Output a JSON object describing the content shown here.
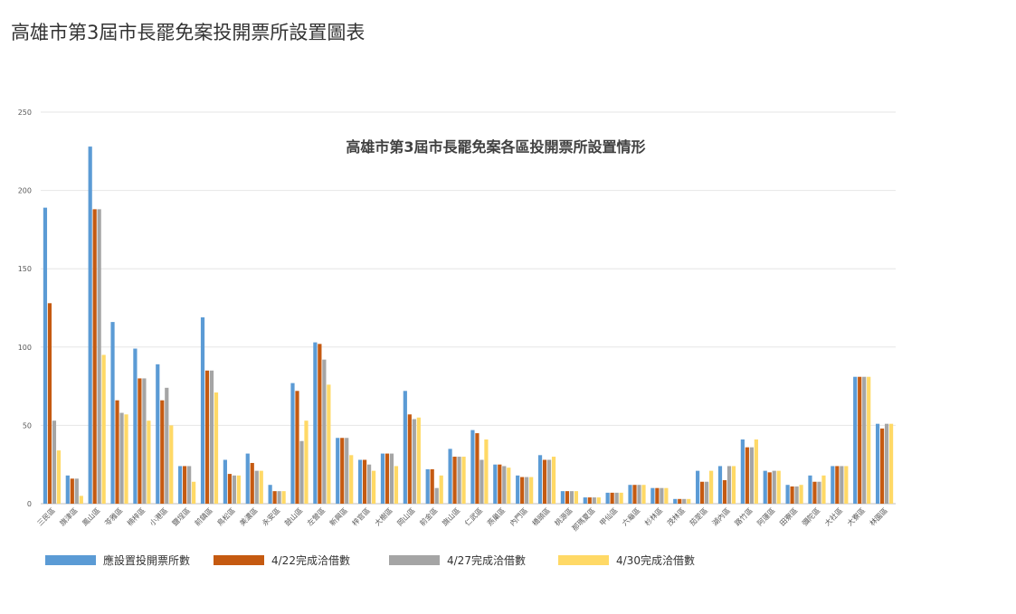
{
  "page": {
    "title": "高雄市第3屆市長罷免案投開票所設置圖表"
  },
  "chart_data": {
    "type": "bar",
    "title": "高雄市第3屆市長罷免案各區投開票所設置情形",
    "xlabel": "",
    "ylabel": "",
    "ylim": [
      0,
      250
    ],
    "yticks": [
      0,
      50,
      100,
      150,
      200,
      250
    ],
    "grid": true,
    "legend_position": "bottom",
    "categories": [
      "三民區",
      "旗津區",
      "鳳山區",
      "苓雅區",
      "楠梓區",
      "小港區",
      "鹽埕區",
      "前鎮區",
      "鳥松區",
      "美濃區",
      "永安區",
      "鼓山區",
      "左營區",
      "新興區",
      "梓官區",
      "大樹區",
      "岡山區",
      "前金區",
      "旗山區",
      "仁武區",
      "燕巢區",
      "內門區",
      "橋頭區",
      "桃源區",
      "那瑪夏區",
      "甲仙區",
      "六龜區",
      "杉林區",
      "茂林區",
      "茄萣區",
      "湖內區",
      "路竹區",
      "阿蓮區",
      "田寮區",
      "彌陀區",
      "大社區",
      "大寮區",
      "林園區"
    ],
    "series": [
      {
        "name": "應設置投開票所數",
        "color": "#5b9bd5",
        "values": [
          189,
          18,
          228,
          116,
          99,
          89,
          24,
          119,
          28,
          32,
          12,
          77,
          103,
          42,
          28,
          32,
          72,
          22,
          35,
          47,
          25,
          18,
          31,
          8,
          4,
          7,
          12,
          10,
          3,
          21,
          24,
          41,
          21,
          12,
          18,
          24,
          81,
          51
        ]
      },
      {
        "name": "4/22完成洽借數",
        "color": "#c55a11",
        "values": [
          128,
          16,
          188,
          66,
          80,
          66,
          24,
          85,
          19,
          26,
          8,
          72,
          102,
          42,
          28,
          32,
          57,
          22,
          30,
          45,
          25,
          17,
          28,
          8,
          4,
          7,
          12,
          10,
          3,
          14,
          15,
          36,
          20,
          11,
          14,
          24,
          81,
          48
        ]
      },
      {
        "name": "4/27完成洽借數",
        "color": "#a5a5a5",
        "values": [
          53,
          16,
          188,
          58,
          80,
          74,
          24,
          85,
          18,
          21,
          8,
          40,
          92,
          42,
          25,
          32,
          54,
          10,
          30,
          28,
          24,
          17,
          28,
          8,
          4,
          7,
          12,
          10,
          3,
          14,
          24,
          36,
          21,
          11,
          14,
          24,
          81,
          51
        ]
      },
      {
        "name": "4/30完成洽借數",
        "color": "#ffd966",
        "values": [
          34,
          5,
          95,
          57,
          53,
          50,
          14,
          71,
          18,
          21,
          8,
          53,
          76,
          31,
          21,
          24,
          55,
          18,
          30,
          41,
          23,
          17,
          30,
          8,
          4,
          7,
          12,
          10,
          3,
          21,
          24,
          41,
          21,
          12,
          18,
          24,
          81,
          51
        ]
      }
    ]
  }
}
